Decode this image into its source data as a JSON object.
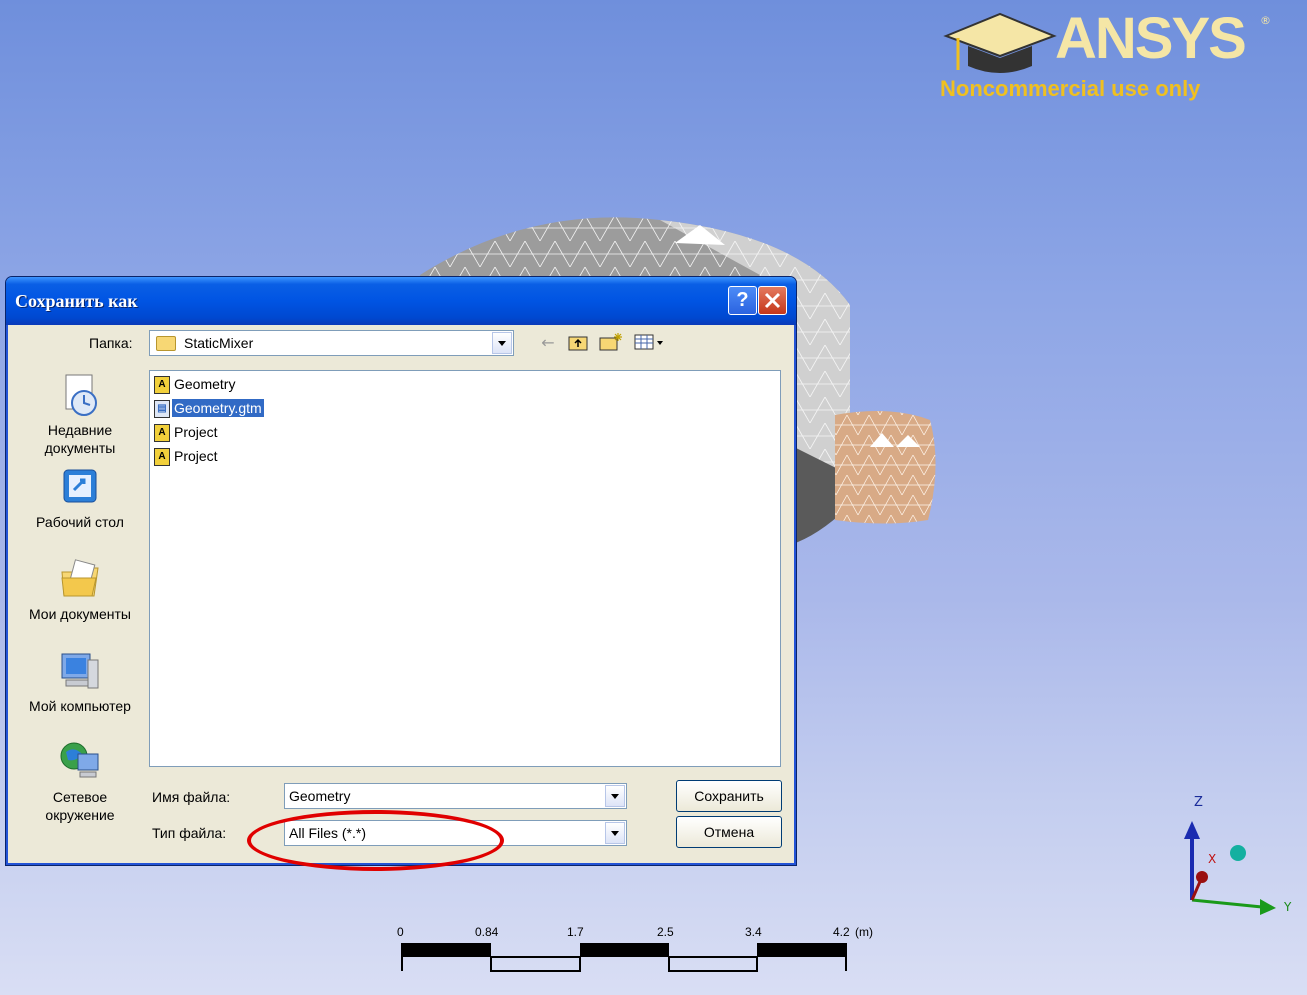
{
  "logo": {
    "brand": "ANSYS",
    "reg_mark": "®",
    "tagline": "Noncommercial use only",
    "icon": "graduation-cap-icon",
    "colors": {
      "brand": "#f5e6a6",
      "tagline": "#f0c020"
    }
  },
  "dialog": {
    "title": "Сохранить как",
    "help_label": "?",
    "close_label": "✕",
    "folder_label": "Папка:",
    "folder_value": "StaticMixer",
    "toolbar": {
      "back_icon": "back-arrow-icon",
      "up_icon": "up-folder-icon",
      "new_folder_icon": "new-folder-icon",
      "views_icon": "views-menu-icon"
    },
    "places": [
      {
        "label": "Недавние документы",
        "icon": "recent-documents-icon"
      },
      {
        "label": "Рабочий стол",
        "icon": "desktop-icon"
      },
      {
        "label": "Мои документы",
        "icon": "my-documents-icon"
      },
      {
        "label": "Мой компьютер",
        "icon": "my-computer-icon"
      },
      {
        "label": "Сетевое окружение",
        "icon": "network-places-icon"
      }
    ],
    "files": [
      {
        "name": "Geometry",
        "icon": "ansys-file-icon",
        "selected": false
      },
      {
        "name": "Geometry.gtm",
        "icon": "gtm-file-icon",
        "selected": true
      },
      {
        "name": "Project",
        "icon": "ansys-file-icon",
        "selected": false
      },
      {
        "name": "Project",
        "icon": "ansys-file-icon",
        "selected": false
      }
    ],
    "filename_label": "Имя файла:",
    "filename_value": "Geometry",
    "filetype_label": "Тип файла:",
    "filetype_value": "All Files (*.*)",
    "save_label": "Сохранить",
    "cancel_label": "Отмена"
  },
  "scale_bar": {
    "ticks": [
      "0",
      "0.84",
      "1.7",
      "2.5",
      "3.4",
      "4.2"
    ],
    "unit": "(m)"
  },
  "triad": {
    "z": "Z",
    "x": "X",
    "y": "Y"
  },
  "annotation": {
    "color": "#e00000",
    "target": "filetype"
  }
}
